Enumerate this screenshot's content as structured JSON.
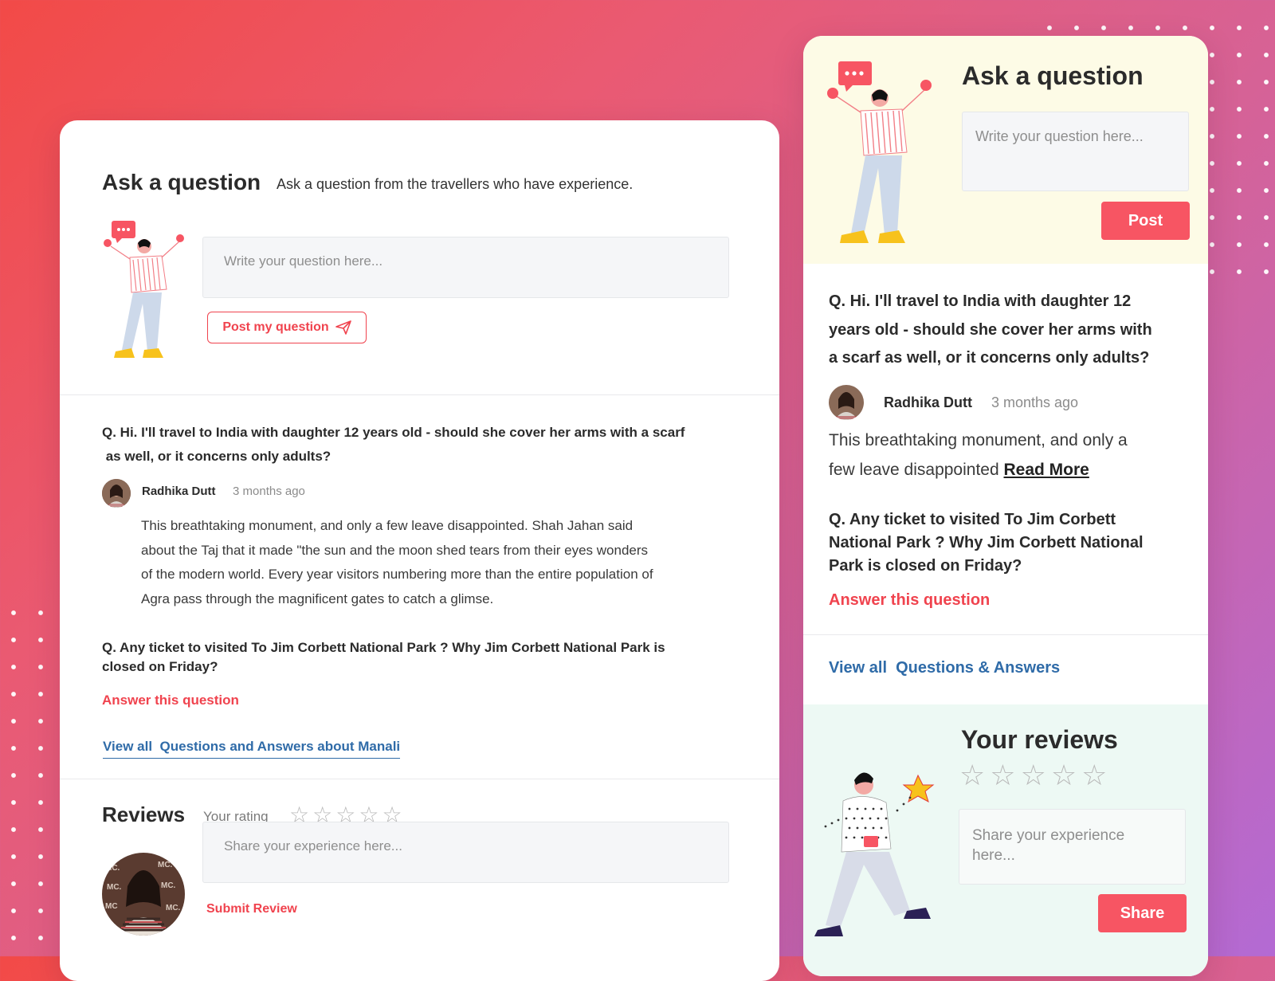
{
  "colors": {
    "accent_red": "#f0434e",
    "link_blue": "#2f6ba8",
    "panel_yellow": "#fdfbe6",
    "panel_mint": "#edf9f4"
  },
  "left": {
    "ask": {
      "title": "Ask a question",
      "subtitle": "Ask a question from the travellers who have experience.",
      "placeholder": "Write your question here...",
      "post_label": "Post my question",
      "post_icon": "paper-plane-icon"
    },
    "questions": [
      {
        "text_line1": "Q. Hi. I'll travel to India with daughter 12 years old - should she cover her arms with a scarf",
        "text_line2": " as well, or it concerns only adults?",
        "author": "Radhika Dutt",
        "time": "3 months ago",
        "answer_lines": [
          "This breathtaking monument, and only a few leave disappointed. Shah Jahan said",
          "about the Taj that it made \"the sun and the moon shed tears from their eyes wonders",
          "of the modern world. Every year visitors numbering more than the entire population of",
          "Agra pass through the magnificent gates to catch a glimse."
        ]
      },
      {
        "text_line1": "Q. Any ticket to visited To Jim Corbett National Park ? Why Jim Corbett National Park is",
        "text_line2": "closed on Friday?",
        "answer_link": "Answer this question"
      }
    ],
    "view_all": "View all  Questions and Answers about Manali",
    "reviews": {
      "title": "Reviews",
      "rating_label": "Your rating",
      "stars": 5,
      "rating_value": 0,
      "placeholder": "Share your experience here...",
      "submit_label": "Submit Review"
    }
  },
  "right": {
    "ask": {
      "title": "Ask a question",
      "placeholder": "Write your question here...",
      "post_label": "Post"
    },
    "q1": {
      "lines": [
        "Q. Hi. I'll travel to India with daughter 12",
        "years old - should she cover her arms with",
        "a scarf as well, or it concerns only adults?"
      ],
      "author": "Radhika Dutt",
      "time": "3 months ago",
      "answer_line1": "This breathtaking monument, and only a",
      "answer_line2": "few leave disappointed",
      "read_more": "Read More"
    },
    "q2": {
      "lines": [
        "Q. Any ticket to visited To Jim Corbett",
        "National Park ? Why Jim Corbett National",
        "Park is closed on Friday?"
      ],
      "answer_link": "Answer this question"
    },
    "view_all": "View all  Questions & Answers",
    "reviews": {
      "title": "Your reviews",
      "stars": 5,
      "rating_value": 0,
      "placeholder_line1": "Share your experience",
      "placeholder_line2": "here...",
      "share_label": "Share"
    }
  }
}
